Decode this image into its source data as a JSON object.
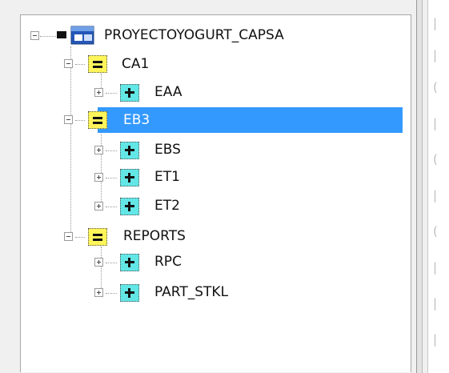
{
  "tree": {
    "root": {
      "label": "PROYECTOYOGURT_CAPSA",
      "icon": "project-window-icon",
      "expanded": true
    },
    "groups": [
      {
        "label": "CA1",
        "icon": "yellow-group-icon",
        "expanded": true,
        "selected": false,
        "children": [
          {
            "label": "EAA",
            "icon": "cyan-item-icon",
            "expanded": false
          }
        ]
      },
      {
        "label": "EB3",
        "icon": "yellow-group-icon",
        "expanded": true,
        "selected": true,
        "children": [
          {
            "label": "EBS",
            "icon": "cyan-item-icon",
            "expanded": false
          },
          {
            "label": "ET1",
            "icon": "cyan-item-icon",
            "expanded": false
          },
          {
            "label": "ET2",
            "icon": "cyan-item-icon",
            "expanded": false
          }
        ]
      },
      {
        "label": "REPORTS",
        "icon": "yellow-group-icon",
        "expanded": true,
        "selected": false,
        "children": [
          {
            "label": "RPC",
            "icon": "cyan-item-icon",
            "expanded": false
          },
          {
            "label": "PART_STKL",
            "icon": "cyan-item-icon",
            "expanded": false
          }
        ]
      }
    ]
  },
  "colors": {
    "selection": "#3399ff",
    "group_icon": "#fff55a",
    "item_icon": "#63e6e6",
    "panel_bg": "#ffffff",
    "window_bg": "#f0f0f0"
  }
}
